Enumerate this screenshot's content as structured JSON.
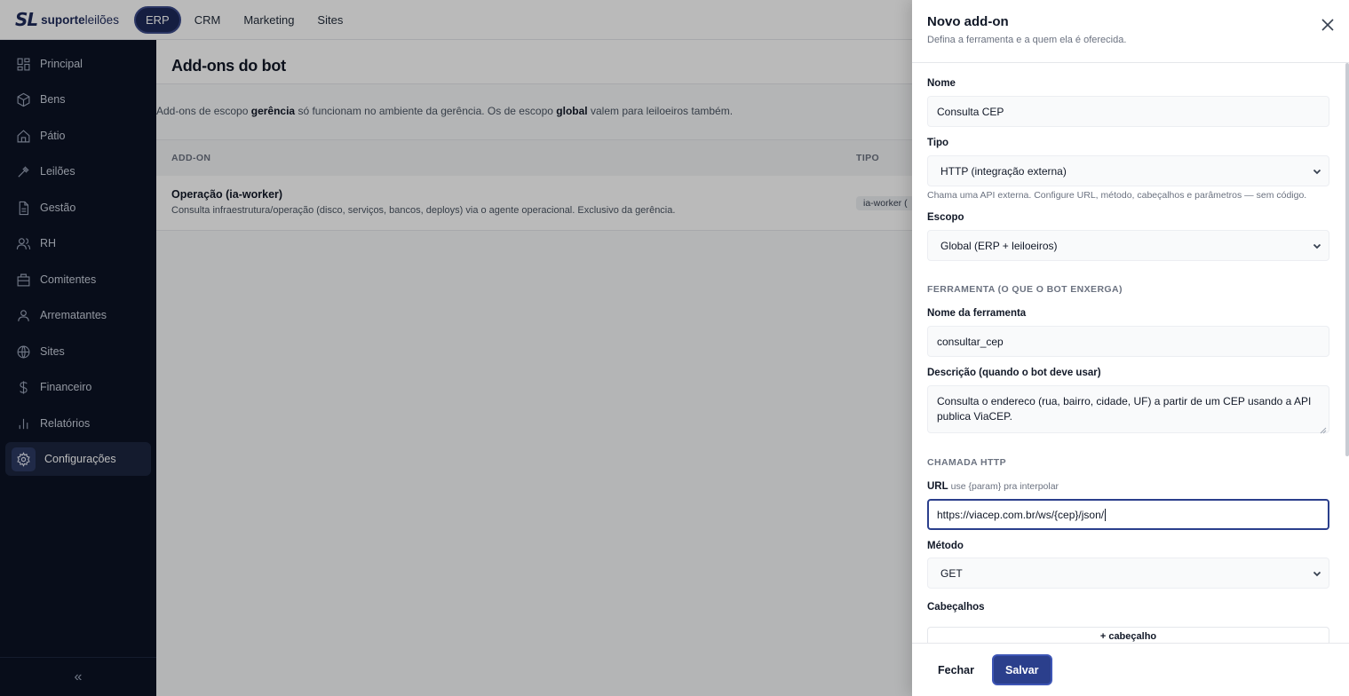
{
  "app": {
    "logo_mark": "SL",
    "logo_bold": "suporte",
    "logo_regular": "leilões"
  },
  "topnav": {
    "tabs": [
      "ERP",
      "CRM",
      "Marketing",
      "Sites"
    ],
    "active": "ERP"
  },
  "sidebar": {
    "items": [
      {
        "label": "Principal",
        "icon": "grid-icon"
      },
      {
        "label": "Bens",
        "icon": "box-icon"
      },
      {
        "label": "Pátio",
        "icon": "home-icon"
      },
      {
        "label": "Leilões",
        "icon": "gavel-icon"
      },
      {
        "label": "Gestão",
        "icon": "document-icon"
      },
      {
        "label": "RH",
        "icon": "users-icon"
      },
      {
        "label": "Comitentes",
        "icon": "building-icon"
      },
      {
        "label": "Arrematantes",
        "icon": "user-icon"
      },
      {
        "label": "Sites",
        "icon": "globe-icon"
      },
      {
        "label": "Financeiro",
        "icon": "dollar-icon"
      },
      {
        "label": "Relatórios",
        "icon": "bar-chart-icon"
      },
      {
        "label": "Configurações",
        "icon": "gear-icon"
      }
    ],
    "active": "Configurações",
    "collapse_glyph": "«"
  },
  "main": {
    "title": "Add-ons do bot",
    "info": {
      "part1": "Add-ons de escopo ",
      "bold1": "gerência",
      "part2": " só funcionam no ambiente da gerência. Os de escopo ",
      "bold2": "global",
      "part3": " valem para leiloeiros também."
    },
    "table": {
      "headers": [
        "ADD-ON",
        "TIPO"
      ],
      "rows": [
        {
          "name": "Operação (ia-worker)",
          "description": "Consulta infraestrutura/operação (disco, serviços, bancos, deploys) via o agente operacional. Exclusivo da gerência.",
          "type": "ia-worker ("
        }
      ]
    }
  },
  "drawer": {
    "title": "Novo add-on",
    "subtitle": "Defina a ferramenta e a quem ela é oferecida.",
    "fields": {
      "nome_label": "Nome",
      "nome_value": "Consulta CEP",
      "tipo_label": "Tipo",
      "tipo_value": "HTTP (integração externa)",
      "tipo_help": "Chama uma API externa. Configure URL, método, cabeçalhos e parâmetros — sem código.",
      "escopo_label": "Escopo",
      "escopo_value": "Global (ERP + leiloeiros)",
      "section_tool": "FERRAMENTA (O QUE O BOT ENXERGA)",
      "tool_name_label": "Nome da ferramenta",
      "tool_name_value": "consultar_cep",
      "desc_label": "Descrição (quando o bot deve usar)",
      "desc_value": "Consulta o endereco (rua, bairro, cidade, UF) a partir de um CEP usando a API publica ViaCEP.",
      "section_http": "CHAMADA HTTP",
      "url_label": "URL",
      "url_hint": "use {param} pra interpolar",
      "url_value": "https://viacep.com.br/ws/{cep}/json/",
      "method_label": "Método",
      "method_value": "GET",
      "headers_label": "Cabeçalhos",
      "add_header": "+ cabeçalho"
    },
    "footer": {
      "close_label": "Fechar",
      "save_label": "Salvar"
    }
  },
  "colors": {
    "brand_navy": "#1e2a5a",
    "primary": "#2b3f8c",
    "sidebar_bg": "#0b1224"
  }
}
